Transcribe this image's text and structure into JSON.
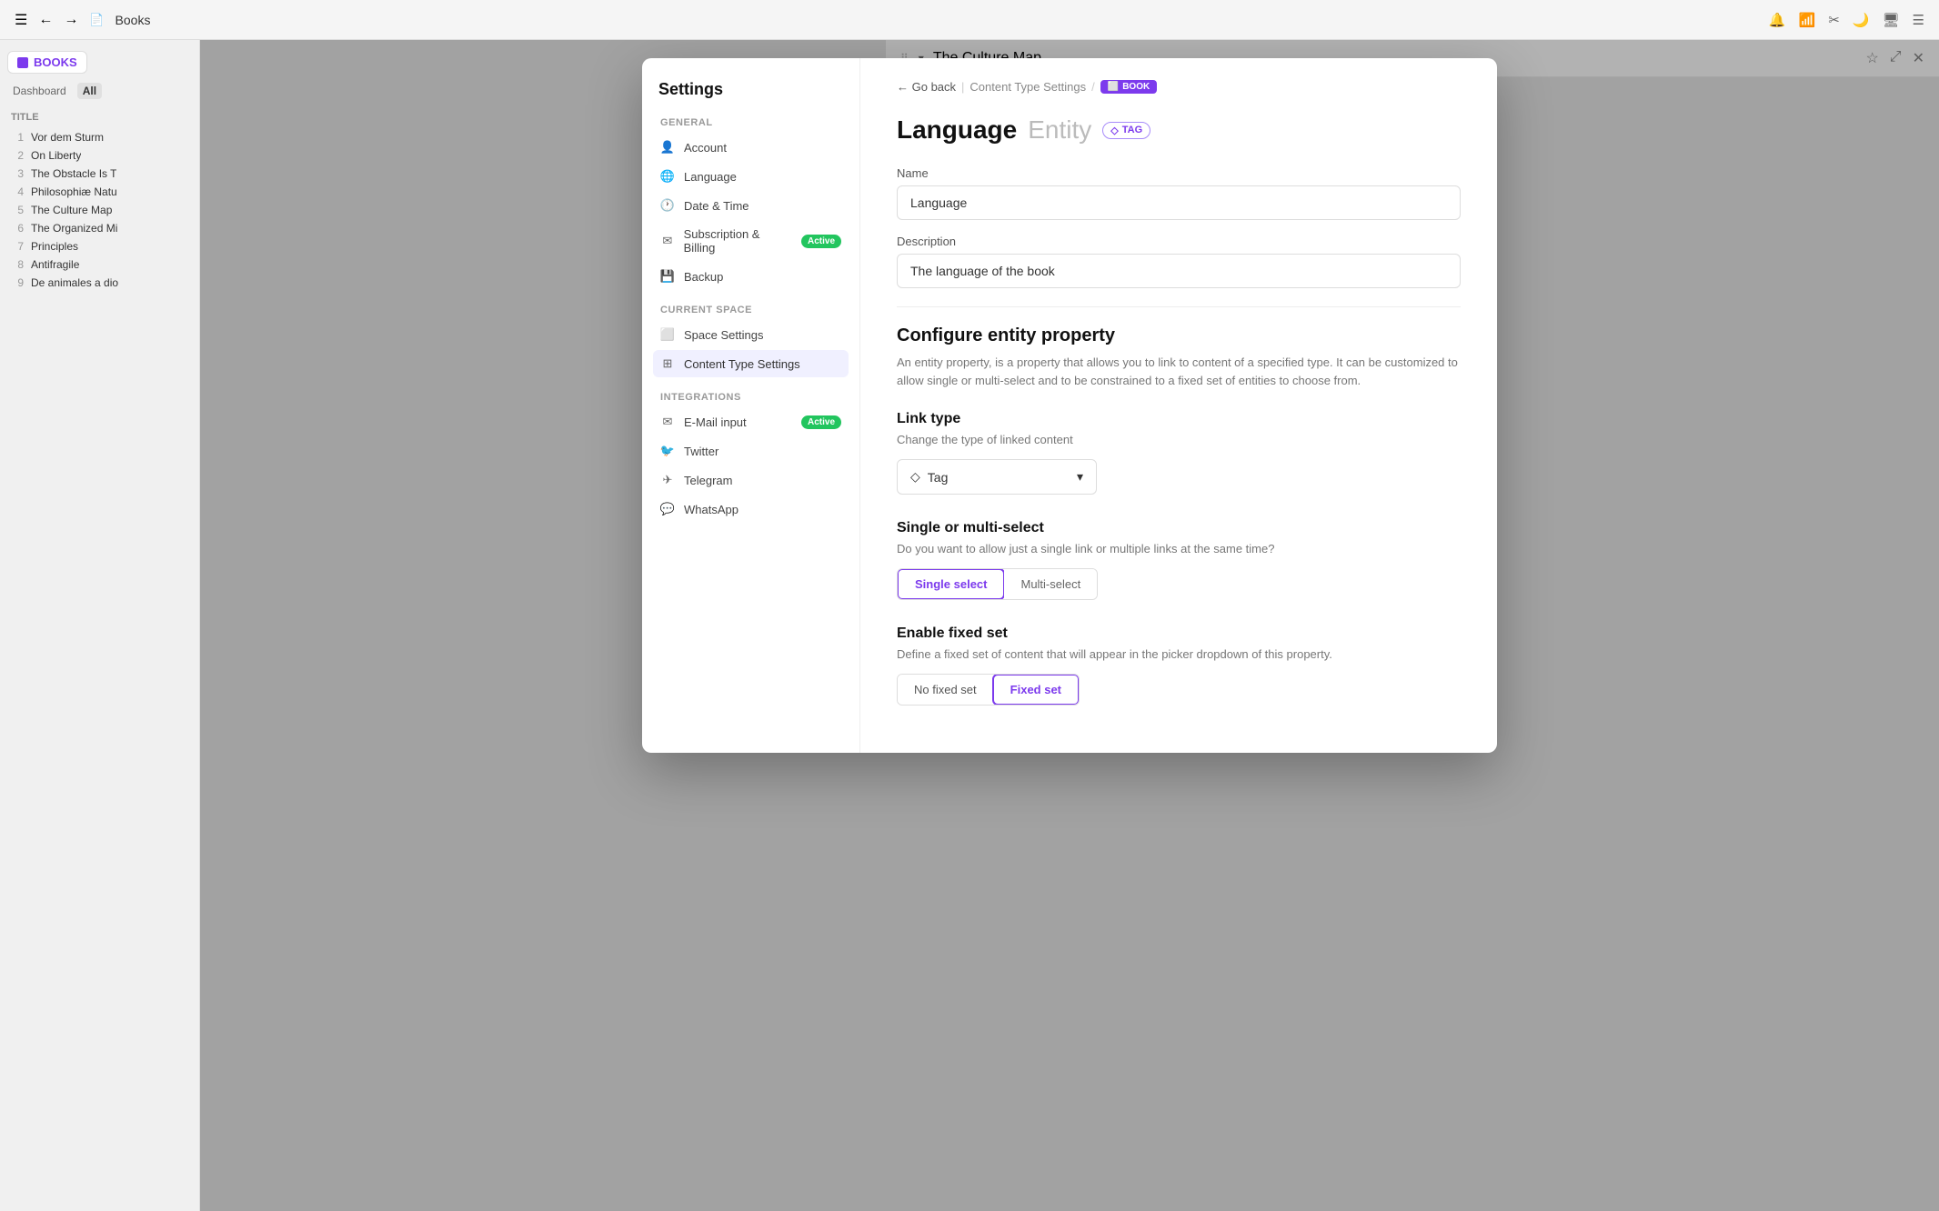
{
  "topbar": {
    "app_title": "Books",
    "icons": [
      "menu",
      "back",
      "forward"
    ]
  },
  "left_sidebar": {
    "app_name": "BOOKS",
    "nav_tabs": [
      "Dashboard",
      "All"
    ],
    "column_header": "TITLE",
    "books": [
      {
        "num": "1",
        "title": "Vor dem Sturm"
      },
      {
        "num": "2",
        "title": "On Liberty"
      },
      {
        "num": "3",
        "title": "The Obstacle Is T"
      },
      {
        "num": "4",
        "title": "Philosophiæ Natu"
      },
      {
        "num": "5",
        "title": "The Culture Map"
      },
      {
        "num": "6",
        "title": "The Organized Mi"
      },
      {
        "num": "7",
        "title": "Principles"
      },
      {
        "num": "8",
        "title": "Antifragile"
      },
      {
        "num": "9",
        "title": "De animales a dio"
      }
    ]
  },
  "floating_panel": {
    "drag_icon": "⠿",
    "title": "The Culture Map",
    "icons": [
      "star",
      "external",
      "close"
    ]
  },
  "settings": {
    "title": "Settings",
    "sections": {
      "general": {
        "label": "GENERAL",
        "items": [
          {
            "id": "account",
            "icon": "👤",
            "label": "Account"
          },
          {
            "id": "language",
            "icon": "🌐",
            "label": "Language"
          },
          {
            "id": "datetime",
            "icon": "🕐",
            "label": "Date & Time"
          },
          {
            "id": "subscription",
            "icon": "📧",
            "label": "Subscription & Billing",
            "badge": "Active"
          },
          {
            "id": "backup",
            "icon": "💾",
            "label": "Backup"
          }
        ]
      },
      "current_space": {
        "label": "CURRENT SPACE",
        "items": [
          {
            "id": "space-settings",
            "icon": "⬜",
            "label": "Space Settings"
          },
          {
            "id": "content-type-settings",
            "icon": "⊞",
            "label": "Content Type Settings",
            "active": true
          }
        ]
      },
      "integrations": {
        "label": "INTEGRATIONS",
        "items": [
          {
            "id": "email",
            "icon": "✉",
            "label": "E-Mail input",
            "badge": "Active"
          },
          {
            "id": "twitter",
            "icon": "🐦",
            "label": "Twitter"
          },
          {
            "id": "telegram",
            "icon": "✈",
            "label": "Telegram"
          },
          {
            "id": "whatsapp",
            "icon": "💬",
            "label": "WhatsApp"
          }
        ]
      }
    }
  },
  "content": {
    "breadcrumb": {
      "back_label": "← Go back",
      "section": "Content Type Settings",
      "separator": "/",
      "badge_icon": "⬜",
      "badge_label": "BOOK"
    },
    "header": {
      "title": "Language",
      "subtitle": "Entity",
      "tag_badge": "TAG"
    },
    "name_field": {
      "label": "Name",
      "value": "Language"
    },
    "description_field": {
      "label": "Description",
      "value": "The language of the book"
    },
    "configure_section": {
      "title": "Configure entity property",
      "description": "An entity property, is a property that allows you to link to content of a specified type. It can be customized to allow single or multi-select and to be constrained to a fixed set of entities to choose from."
    },
    "link_type": {
      "title": "Link type",
      "description": "Change the type of linked content",
      "selected": "Tag",
      "tag_icon": "◇"
    },
    "select_type": {
      "title": "Single or multi-select",
      "description": "Do you want to allow just a single link or multiple links at the same time?",
      "options": [
        "Single select",
        "Multi-select"
      ],
      "active": "Single select"
    },
    "fixed_set": {
      "title": "Enable fixed set",
      "description": "Define a fixed set of content that will appear in the picker dropdown of this property.",
      "options": [
        "No fixed set",
        "Fixed set"
      ],
      "active": "Fixed set"
    }
  }
}
